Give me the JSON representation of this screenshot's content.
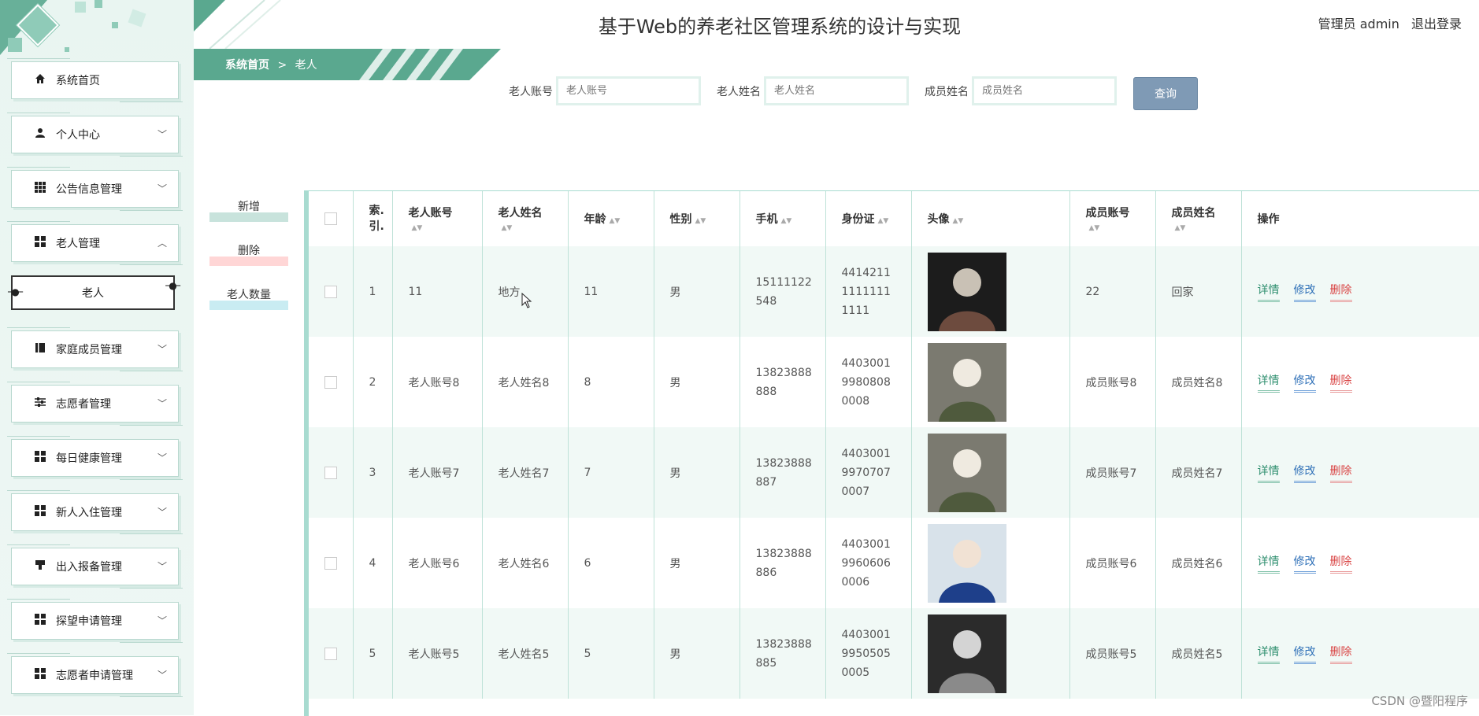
{
  "header": {
    "title": "基于Web的养老社区管理系统的设计与实现",
    "user_role": "管理员 admin",
    "logout": "退出登录"
  },
  "breadcrumb": {
    "home": "系统首页",
    "separator": ">",
    "current": "老人"
  },
  "sidebar": {
    "items": [
      {
        "label": "系统首页",
        "icon": "home-icon"
      },
      {
        "label": "个人中心",
        "icon": "user-icon"
      },
      {
        "label": "公告信息管理",
        "icon": "grid-icon"
      },
      {
        "label": "老人管理",
        "icon": "apps-icon"
      },
      {
        "label": "家庭成员管理",
        "icon": "book-icon"
      },
      {
        "label": "志愿者管理",
        "icon": "sliders-icon"
      },
      {
        "label": "每日健康管理",
        "icon": "apps-icon"
      },
      {
        "label": "新人入住管理",
        "icon": "apps-icon"
      },
      {
        "label": "出入报备管理",
        "icon": "stamp-icon"
      },
      {
        "label": "探望申请管理",
        "icon": "apps-icon"
      },
      {
        "label": "志愿者申请管理",
        "icon": "apps-icon"
      }
    ],
    "active_sub": "老人"
  },
  "search": {
    "field1_label": "老人账号",
    "field1_placeholder": "老人账号",
    "field2_label": "老人姓名",
    "field2_placeholder": "老人姓名",
    "field3_label": "成员姓名",
    "field3_placeholder": "成员姓名",
    "button": "查询"
  },
  "actions": {
    "add": "新增",
    "delete": "删除",
    "count": "老人数量"
  },
  "table": {
    "headers": [
      "索.引.",
      "老人账号",
      "老人姓名",
      "年龄",
      "性别",
      "手机",
      "身份证",
      "头像",
      "成员账号",
      "成员姓名",
      "操作"
    ],
    "rows": [
      {
        "idx": "1",
        "account": "11",
        "name": "地方",
        "age": "11",
        "gender": "男",
        "phone": "15111122548",
        "idcard": "441421111111111111",
        "member_account": "22",
        "member_name": "回家"
      },
      {
        "idx": "2",
        "account": "老人账号8",
        "name": "老人姓名8",
        "age": "8",
        "gender": "男",
        "phone": "13823888888",
        "idcard": "440300199808080008",
        "member_account": "成员账号8",
        "member_name": "成员姓名8"
      },
      {
        "idx": "3",
        "account": "老人账号7",
        "name": "老人姓名7",
        "age": "7",
        "gender": "男",
        "phone": "13823888887",
        "idcard": "440300199707070007",
        "member_account": "成员账号7",
        "member_name": "成员姓名7"
      },
      {
        "idx": "4",
        "account": "老人账号6",
        "name": "老人姓名6",
        "age": "6",
        "gender": "男",
        "phone": "13823888886",
        "idcard": "440300199606060006",
        "member_account": "成员账号6",
        "member_name": "成员姓名6"
      },
      {
        "idx": "5",
        "account": "老人账号5",
        "name": "老人姓名5",
        "age": "5",
        "gender": "男",
        "phone": "13823888885",
        "idcard": "440300199505050005",
        "member_account": "成员账号5",
        "member_name": "成员姓名5"
      }
    ],
    "ops": {
      "detail": "详情",
      "edit": "修改",
      "delete": "删除"
    }
  },
  "watermark": "CSDN @暨阳程序",
  "colors": {
    "accent": "#5aa88f",
    "query_button": "#7f9ab5",
    "row_stripe": "#f1f9f6"
  }
}
